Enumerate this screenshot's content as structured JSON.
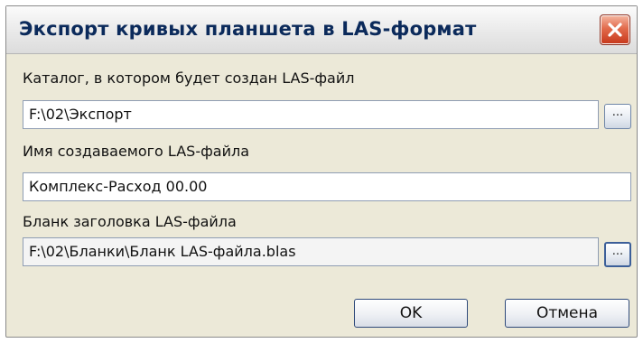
{
  "window": {
    "title": "Экспорт кривых планшета в LAS-формат",
    "close_icon": "close-icon"
  },
  "form": {
    "catalog_label": "Каталог, в котором будет создан LAS-файл",
    "catalog_value": "F:\\02\\Экспорт",
    "filename_label": "Имя создаваемого LAS-файла",
    "filename_value": "Комплекс-Расход 00.00",
    "template_label": "Бланк заголовка LAS-файла",
    "template_value": "F:\\02\\Бланки\\Бланк LAS-файла.blas",
    "browse_label": "..."
  },
  "buttons": {
    "ok": "OK",
    "cancel": "Отмена"
  },
  "colors": {
    "title_text": "#0b2a5b",
    "close_button": "#d9553a",
    "dialog_background": "#ece9d8"
  }
}
